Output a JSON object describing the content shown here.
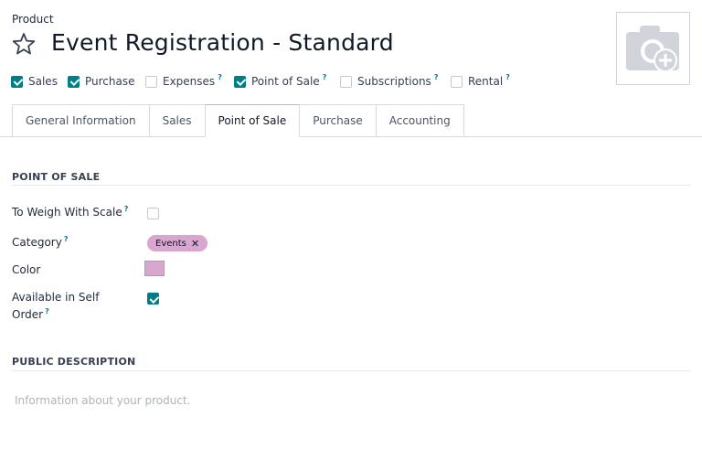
{
  "header": {
    "breadcrumb_label": "Product",
    "title": "Event Registration - Standard",
    "favorite_icon": "star-outline-icon",
    "photo_icon": "camera-plus-icon"
  },
  "options": [
    {
      "label": "Sales",
      "checked": true,
      "help": false
    },
    {
      "label": "Purchase",
      "checked": true,
      "help": false
    },
    {
      "label": "Expenses",
      "checked": false,
      "help": true
    },
    {
      "label": "Point of Sale",
      "checked": true,
      "help": true
    },
    {
      "label": "Subscriptions",
      "checked": false,
      "help": true
    },
    {
      "label": "Rental",
      "checked": false,
      "help": true
    }
  ],
  "help_mark": "?",
  "tabs": [
    {
      "label": "General Information",
      "active": false
    },
    {
      "label": "Sales",
      "active": false
    },
    {
      "label": "Point of Sale",
      "active": true
    },
    {
      "label": "Purchase",
      "active": false
    },
    {
      "label": "Accounting",
      "active": false
    }
  ],
  "pos_section": {
    "heading": "POINT OF SALE",
    "to_weigh_label": "To Weigh With Scale",
    "to_weigh_checked": false,
    "category_label": "Category",
    "category_tag": "Events",
    "tag_remove": "✕",
    "color_label": "Color",
    "color_value": "#d8a6cf",
    "self_order_label_line1": "Available in Self",
    "self_order_label_line2": "Order",
    "self_order_checked": true
  },
  "public_description": {
    "heading": "PUBLIC DESCRIPTION",
    "placeholder": "Information about your product."
  },
  "colors": {
    "accent": "#017e84",
    "tag": "#d8a6cf",
    "help": "#0b7a8a"
  }
}
